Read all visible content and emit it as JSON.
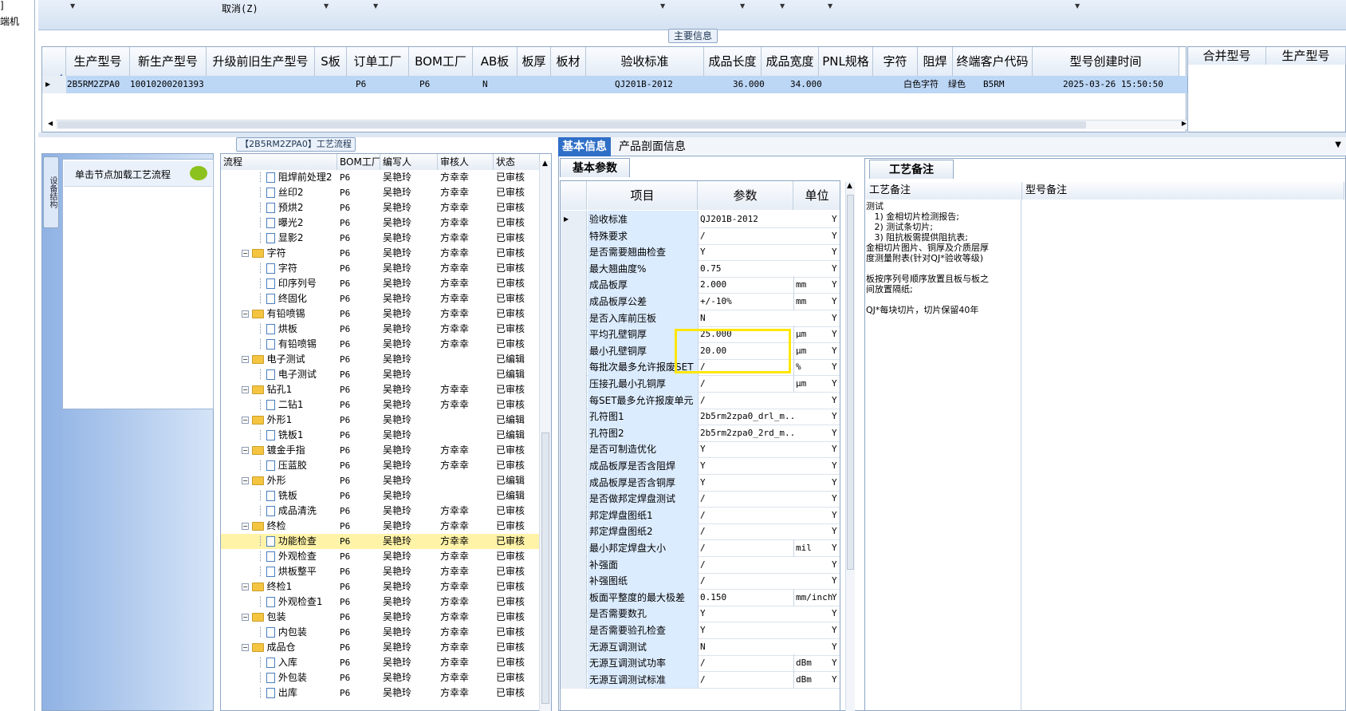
{
  "left_strip": {
    "items": [
      "]",
      "端机"
    ]
  },
  "toolbar": {
    "cancel_label": "取消(Z)"
  },
  "main_info": {
    "title": "主要信息",
    "columns": [
      "生产型号",
      "新生产型号",
      "升级前旧生产型号",
      "S板",
      "订单工厂",
      "BOM工厂",
      "AB板",
      "板厚",
      "板材",
      "验收标准",
      "成品长度",
      "成品宽度",
      "PNL规格",
      "字符",
      "阻焊",
      "终端客户代码",
      "型号创建时间"
    ],
    "row": {
      "prod_model": "2B5RM2ZPA0",
      "new_model": "10010200201393",
      "order_factory": "P6",
      "bom_factory": "P6",
      "ab": "N",
      "standard": "QJ201B-2012",
      "length": "36.000",
      "width": "34.000",
      "char": "白色字符",
      "solder": "绿色",
      "customer": "B5RM",
      "created": "2025-03-26 15:50:50"
    }
  },
  "merge_panel": {
    "columns": [
      "合并型号",
      "生产型号"
    ]
  },
  "flow_panel": {
    "title": "【2B5RM2ZPA0】工艺流程",
    "side_tab": "设备结构",
    "card_text": "单击节点加载工艺流程",
    "columns": [
      "流程",
      "BOM工厂",
      "编写人",
      "审核人",
      "状态"
    ],
    "rows": [
      {
        "t": "n",
        "name": "阻焊前处理2",
        "bom": "P6",
        "w": "吴艳玲",
        "r": "方幸幸",
        "s": "已审核"
      },
      {
        "t": "n",
        "name": "丝印2",
        "bom": "P6",
        "w": "吴艳玲",
        "r": "方幸幸",
        "s": "已审核"
      },
      {
        "t": "n",
        "name": "预烘2",
        "bom": "P6",
        "w": "吴艳玲",
        "r": "方幸幸",
        "s": "已审核"
      },
      {
        "t": "n",
        "name": "曝光2",
        "bom": "P6",
        "w": "吴艳玲",
        "r": "方幸幸",
        "s": "已审核"
      },
      {
        "t": "n",
        "name": "显影2",
        "bom": "P6",
        "w": "吴艳玲",
        "r": "方幸幸",
        "s": "已审核"
      },
      {
        "t": "g",
        "name": "字符",
        "bom": "P6",
        "w": "吴艳玲",
        "r": "方幸幸",
        "s": "已审核"
      },
      {
        "t": "n",
        "name": "字符",
        "bom": "P6",
        "w": "吴艳玲",
        "r": "方幸幸",
        "s": "已审核"
      },
      {
        "t": "n",
        "name": "印序列号",
        "bom": "P6",
        "w": "吴艳玲",
        "r": "方幸幸",
        "s": "已审核"
      },
      {
        "t": "n",
        "name": "终固化",
        "bom": "P6",
        "w": "吴艳玲",
        "r": "方幸幸",
        "s": "已审核"
      },
      {
        "t": "g",
        "name": "有铅喷锡",
        "bom": "P6",
        "w": "吴艳玲",
        "r": "方幸幸",
        "s": "已审核"
      },
      {
        "t": "n",
        "name": "烘板",
        "bom": "P6",
        "w": "吴艳玲",
        "r": "方幸幸",
        "s": "已审核"
      },
      {
        "t": "n",
        "name": "有铅喷锡",
        "bom": "P6",
        "w": "吴艳玲",
        "r": "方幸幸",
        "s": "已审核"
      },
      {
        "t": "g",
        "name": "电子测试",
        "bom": "P6",
        "w": "吴艳玲",
        "r": "",
        "s": "已编辑"
      },
      {
        "t": "n",
        "name": "电子测试",
        "bom": "P6",
        "w": "吴艳玲",
        "r": "",
        "s": "已编辑"
      },
      {
        "t": "g",
        "name": "钻孔1",
        "bom": "P6",
        "w": "吴艳玲",
        "r": "方幸幸",
        "s": "已审核"
      },
      {
        "t": "n",
        "name": "二钻1",
        "bom": "P6",
        "w": "吴艳玲",
        "r": "方幸幸",
        "s": "已审核"
      },
      {
        "t": "g",
        "name": "外形1",
        "bom": "P6",
        "w": "吴艳玲",
        "r": "",
        "s": "已编辑"
      },
      {
        "t": "n",
        "name": "铣板1",
        "bom": "P6",
        "w": "吴艳玲",
        "r": "",
        "s": "已编辑"
      },
      {
        "t": "g",
        "name": "镀金手指",
        "bom": "P6",
        "w": "吴艳玲",
        "r": "方幸幸",
        "s": "已审核"
      },
      {
        "t": "n",
        "name": "压蓝胶",
        "bom": "P6",
        "w": "吴艳玲",
        "r": "方幸幸",
        "s": "已审核"
      },
      {
        "t": "g",
        "name": "外形",
        "bom": "P6",
        "w": "吴艳玲",
        "r": "",
        "s": "已编辑"
      },
      {
        "t": "n",
        "name": "铣板",
        "bom": "P6",
        "w": "吴艳玲",
        "r": "",
        "s": "已编辑"
      },
      {
        "t": "n",
        "name": "成品清洗",
        "bom": "P6",
        "w": "吴艳玲",
        "r": "方幸幸",
        "s": "已审核"
      },
      {
        "t": "g",
        "name": "终检",
        "bom": "P6",
        "w": "吴艳玲",
        "r": "方幸幸",
        "s": "已审核"
      },
      {
        "t": "n",
        "name": "功能检查",
        "bom": "P6",
        "w": "吴艳玲",
        "r": "方幸幸",
        "s": "已审核",
        "sel": true
      },
      {
        "t": "n",
        "name": "外观检查",
        "bom": "P6",
        "w": "吴艳玲",
        "r": "方幸幸",
        "s": "已审核"
      },
      {
        "t": "n",
        "name": "烘板整平",
        "bom": "P6",
        "w": "吴艳玲",
        "r": "方幸幸",
        "s": "已审核"
      },
      {
        "t": "g",
        "name": "终检1",
        "bom": "P6",
        "w": "吴艳玲",
        "r": "方幸幸",
        "s": "已审核"
      },
      {
        "t": "n",
        "name": "外观检查1",
        "bom": "P6",
        "w": "吴艳玲",
        "r": "方幸幸",
        "s": "已审核"
      },
      {
        "t": "g",
        "name": "包装",
        "bom": "P6",
        "w": "吴艳玲",
        "r": "方幸幸",
        "s": "已审核"
      },
      {
        "t": "n",
        "name": "内包装",
        "bom": "P6",
        "w": "吴艳玲",
        "r": "方幸幸",
        "s": "已审核"
      },
      {
        "t": "g",
        "name": "成品仓",
        "bom": "P6",
        "w": "吴艳玲",
        "r": "方幸幸",
        "s": "已审核"
      },
      {
        "t": "n",
        "name": "入库",
        "bom": "P6",
        "w": "吴艳玲",
        "r": "方幸幸",
        "s": "已审核"
      },
      {
        "t": "n",
        "name": "外包装",
        "bom": "P6",
        "w": "吴艳玲",
        "r": "方幸幸",
        "s": "已审核"
      },
      {
        "t": "n",
        "name": "出库",
        "bom": "P6",
        "w": "吴艳玲",
        "r": "方幸幸",
        "s": "已审核"
      }
    ]
  },
  "detail": {
    "tab_active": "基本信息",
    "tab_2": "产品剖面信息",
    "subtab": "基本参数",
    "columns": [
      "项目",
      "参数",
      "单位"
    ],
    "rows": [
      {
        "k": "验收标准",
        "v": "QJ201B-2012",
        "u": "",
        "y": "Y"
      },
      {
        "k": "特殊要求",
        "v": "/",
        "u": "",
        "y": "Y"
      },
      {
        "k": "是否需要翘曲检查",
        "v": "Y",
        "u": "",
        "y": "Y"
      },
      {
        "k": "最大翘曲度%",
        "v": "0.75",
        "u": "",
        "y": "Y"
      },
      {
        "k": "成品板厚",
        "v": "2.000",
        "u": "mm",
        "y": "Y"
      },
      {
        "k": "成品板厚公差",
        "v": "+/-10%",
        "u": "mm",
        "y": "Y"
      },
      {
        "k": "是否入库前压板",
        "v": "N",
        "u": "",
        "y": "Y"
      },
      {
        "k": "平均孔壁铜厚",
        "v": "25.000",
        "u": "μm",
        "y": "Y"
      },
      {
        "k": "最小孔壁铜厚",
        "v": "20.00",
        "u": "μm",
        "y": "Y"
      },
      {
        "k": "每批次最多允许报废SET",
        "v": "/",
        "u": "%",
        "y": "Y"
      },
      {
        "k": "压接孔最小孔铜厚",
        "v": "/",
        "u": "μm",
        "y": "Y"
      },
      {
        "k": "每SET最多允许报废单元",
        "v": "/",
        "u": "",
        "y": "Y"
      },
      {
        "k": "孔符图1",
        "v": "2b5rm2zpa0_drl_m...",
        "u": "",
        "y": "Y"
      },
      {
        "k": "孔符图2",
        "v": "2b5rm2zpa0_2rd_m...",
        "u": "",
        "y": "Y"
      },
      {
        "k": "是否可制造优化",
        "v": "Y",
        "u": "",
        "y": "Y"
      },
      {
        "k": "成品板厚是否含阻焊",
        "v": "Y",
        "u": "",
        "y": "Y"
      },
      {
        "k": "成品板厚是否含铜厚",
        "v": "Y",
        "u": "",
        "y": "Y"
      },
      {
        "k": "是否做邦定焊盘测试",
        "v": "/",
        "u": "",
        "y": "Y"
      },
      {
        "k": "邦定焊盘图纸1",
        "v": "/",
        "u": "",
        "y": "Y"
      },
      {
        "k": "邦定焊盘图纸2",
        "v": "/",
        "u": "",
        "y": "Y"
      },
      {
        "k": "最小邦定焊盘大小",
        "v": "/",
        "u": "mil",
        "y": "Y"
      },
      {
        "k": "补强面",
        "v": "/",
        "u": "",
        "y": "Y"
      },
      {
        "k": "补强图纸",
        "v": "/",
        "u": "",
        "y": "Y"
      },
      {
        "k": "板面平整度的最大极差",
        "v": "0.150",
        "u": "mm/inch",
        "y": "Y"
      },
      {
        "k": "是否需要数孔",
        "v": "Y",
        "u": "",
        "y": "Y"
      },
      {
        "k": "是否需要验孔检查",
        "v": "Y",
        "u": "",
        "y": "Y"
      },
      {
        "k": "无源互调测试",
        "v": "N",
        "u": "",
        "y": "Y"
      },
      {
        "k": "无源互调测试功率",
        "v": "/",
        "u": "dBm",
        "y": "Y"
      },
      {
        "k": "无源互调测试标准",
        "v": "/",
        "u": "dBm",
        "y": "Y"
      }
    ]
  },
  "notes": {
    "tab": "工艺备注",
    "col1": "工艺备注",
    "col2": "型号备注",
    "text": "测试\n   1) 金相切片检测报告;\n   2) 测试条切片;\n   3) 阻抗板需提供阻抗表;\n金相切片图片、铜厚及介质层厚\n度测量附表(针对QJ*验收等级)\n\n板按序列号顺序放置且板与板之\n间放置隔纸;\n\nQJ*每块切片，切片保留40年"
  }
}
